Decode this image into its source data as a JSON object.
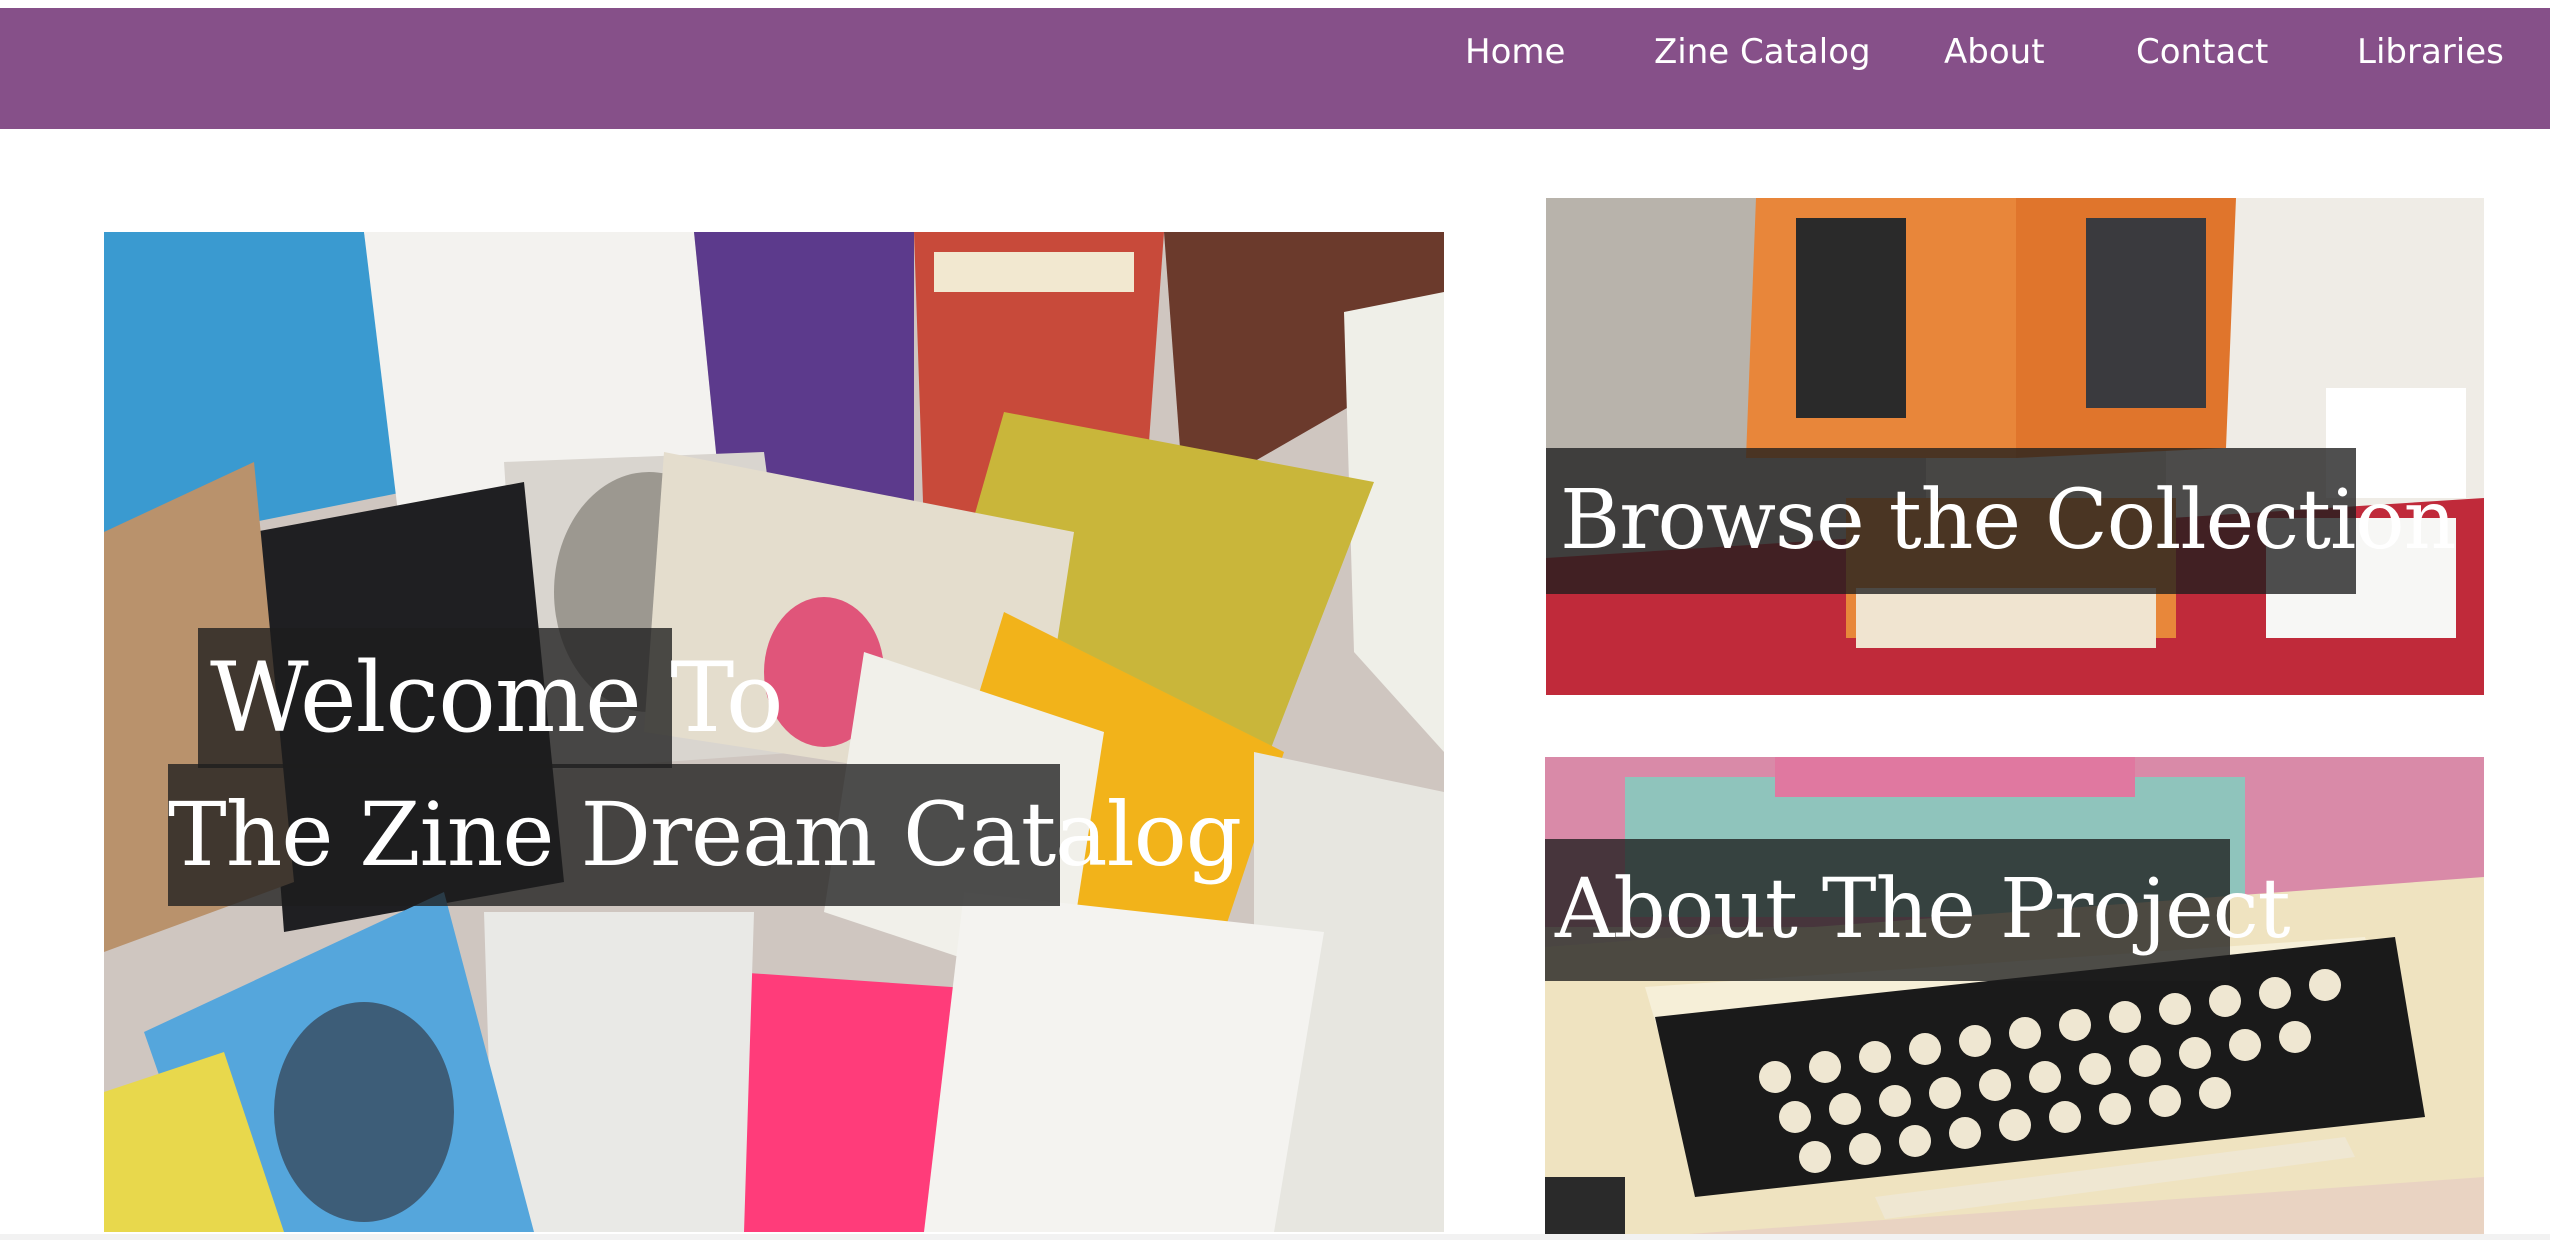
{
  "nav": {
    "items": [
      {
        "label": "Home"
      },
      {
        "label": "Zine Catalog"
      },
      {
        "label": "About"
      },
      {
        "label": "Contact"
      },
      {
        "label": "Libraries"
      }
    ]
  },
  "hero": {
    "line1": "Welcome To",
    "line2": "The Zine Dream Catalog"
  },
  "tiles": {
    "browse": {
      "label": "Browse the Collection"
    },
    "about": {
      "label": "About The Project"
    }
  },
  "colors": {
    "nav_bg": "#865089",
    "caption_bg": "rgba(30,30,30,0.78)"
  }
}
